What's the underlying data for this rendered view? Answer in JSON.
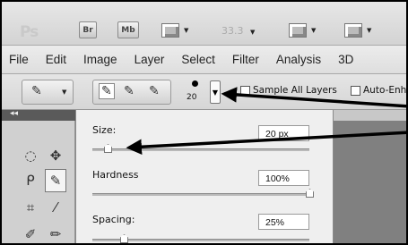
{
  "app_bar": {
    "logo": "Ps",
    "bridge_button": "Br",
    "minibridge_button": "Mb",
    "zoom_level": "33.3",
    "dropdown_glyph": "▼"
  },
  "menu": [
    "File",
    "Edit",
    "Image",
    "Layer",
    "Select",
    "Filter",
    "Analysis",
    "3D"
  ],
  "options_bar": {
    "brush_size_value": "20",
    "picker_glyph": "▼",
    "sample_all_layers_label": "Sample All Layers",
    "auto_enhance_label": "Auto-Enh",
    "sample_all_layers_checked": false,
    "auto_enhance_checked": false
  },
  "tools_header": "◂◂",
  "brush_picker": {
    "size_label": "Size:",
    "size_value": "20 px",
    "size_level": 0.06,
    "hardness_label": "Hardness",
    "hardness_value": "100%",
    "hardness_level": 1.0,
    "spacing_label": "Spacing:",
    "spacing_value": "25%",
    "spacing_level": 0.14
  },
  "icons": {
    "marquee": "◌",
    "move": "✥",
    "lasso": "ᑭ",
    "quick-select": "✎",
    "crop": "⌗",
    "eyedropper": "⁄",
    "healing": "✐",
    "brush": "✏"
  },
  "colors": {
    "arrow": "#000000",
    "panel_bg": "#efefef",
    "canvas_bg": "#808080"
  }
}
